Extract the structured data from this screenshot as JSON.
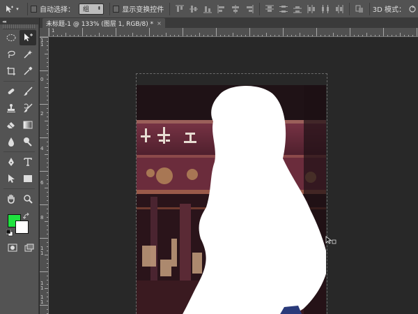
{
  "options_bar": {
    "auto_select_label": "自动选择：",
    "auto_select_value": "组",
    "show_transform_label": "显示变换控件",
    "mode_3d_label": "3D 模式："
  },
  "tab": {
    "title": "未标题-1 @ 133% (图层 1, RGB/8) *",
    "close": "×"
  },
  "panel_collapse": "◂◂",
  "rulers": {
    "top_label": "1",
    "left_labels": [
      "1",
      "1",
      "0",
      "2",
      "4",
      "6",
      "8",
      "1",
      "1",
      "1",
      "1",
      "1",
      "1"
    ]
  },
  "colors": {
    "foreground": "#1ee33f",
    "background": "#ffffff",
    "ui_panel": "#535353",
    "workspace": "#282828"
  },
  "tools": [
    [
      "marquee-tool-icon",
      "move-tool-icon"
    ],
    [
      "lasso-tool-icon",
      "magic-wand-icon"
    ],
    [
      "crop-tool-icon",
      "eyedropper-icon"
    ],
    [
      "healing-brush-icon",
      "brush-tool-icon"
    ],
    [
      "clone-stamp-icon",
      "history-brush-icon"
    ],
    [
      "eraser-icon",
      "gradient-tool-icon"
    ],
    [
      "blur-tool-icon",
      "dodge-tool-icon"
    ],
    [
      "pen-tool-icon",
      "type-tool-icon"
    ],
    [
      "path-select-icon",
      "rectangle-tool-icon"
    ],
    [
      "hand-tool-icon",
      "zoom-tool-icon"
    ]
  ]
}
